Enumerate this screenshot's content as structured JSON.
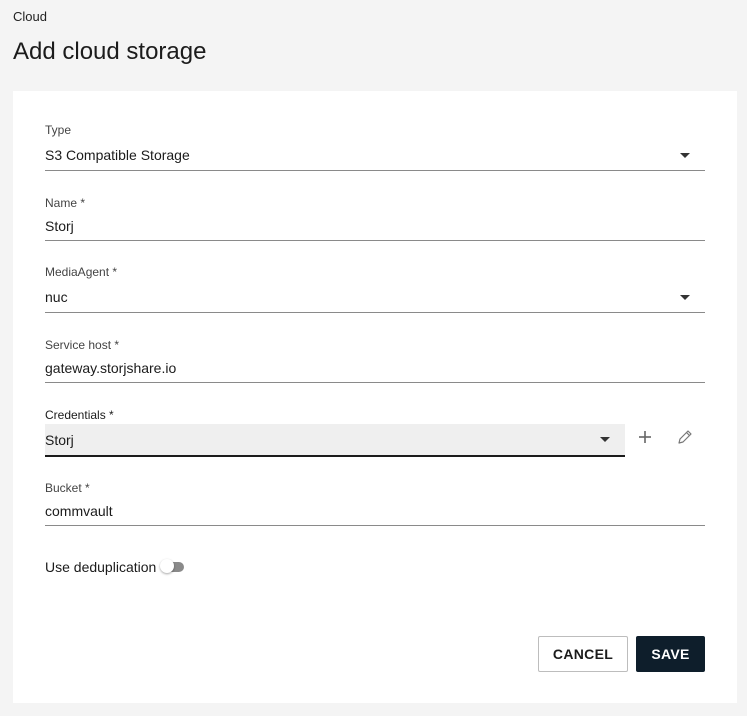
{
  "breadcrumb": "Cloud",
  "title": "Add cloud storage",
  "form": {
    "type": {
      "label": "Type",
      "value": "S3 Compatible Storage"
    },
    "name": {
      "label": "Name *",
      "value": "Storj"
    },
    "media_agent": {
      "label": "MediaAgent *",
      "value": "nuc"
    },
    "service_host": {
      "label": "Service host *",
      "value": "gateway.storjshare.io"
    },
    "credentials": {
      "label": "Credentials *",
      "value": "Storj",
      "add_icon": "plus-icon",
      "edit_icon": "pencil-icon"
    },
    "bucket": {
      "label": "Bucket *",
      "value": "commvault"
    },
    "deduplication": {
      "label": "Use deduplication",
      "enabled": false
    }
  },
  "actions": {
    "cancel_label": "CANCEL",
    "save_label": "SAVE"
  },
  "colors": {
    "background": "#f4f4f4",
    "card": "#ffffff",
    "primary_button": "#0e1e2b",
    "field_active_bg": "#efefef"
  }
}
